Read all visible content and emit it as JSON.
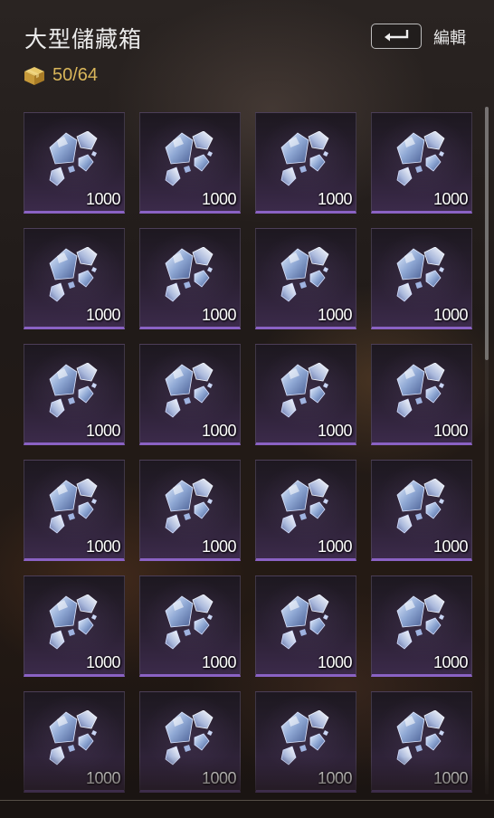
{
  "header": {
    "title": "大型儲藏箱",
    "capacity": "50/64",
    "edit_label": "編輯"
  },
  "icons": {
    "capacity": "box-icon",
    "back": "return-arrow-icon",
    "item": "crystal-shards-icon"
  },
  "colors": {
    "capacity_text": "#d9b65a",
    "slot_rarity_bar": "#8a62c4",
    "title_text": "#ececec"
  },
  "inventory": {
    "columns": 4,
    "items": [
      {
        "icon": "crystal-shards-icon",
        "quantity": "1000"
      },
      {
        "icon": "crystal-shards-icon",
        "quantity": "1000"
      },
      {
        "icon": "crystal-shards-icon",
        "quantity": "1000"
      },
      {
        "icon": "crystal-shards-icon",
        "quantity": "1000"
      },
      {
        "icon": "crystal-shards-icon",
        "quantity": "1000"
      },
      {
        "icon": "crystal-shards-icon",
        "quantity": "1000"
      },
      {
        "icon": "crystal-shards-icon",
        "quantity": "1000"
      },
      {
        "icon": "crystal-shards-icon",
        "quantity": "1000"
      },
      {
        "icon": "crystal-shards-icon",
        "quantity": "1000"
      },
      {
        "icon": "crystal-shards-icon",
        "quantity": "1000"
      },
      {
        "icon": "crystal-shards-icon",
        "quantity": "1000"
      },
      {
        "icon": "crystal-shards-icon",
        "quantity": "1000"
      },
      {
        "icon": "crystal-shards-icon",
        "quantity": "1000"
      },
      {
        "icon": "crystal-shards-icon",
        "quantity": "1000"
      },
      {
        "icon": "crystal-shards-icon",
        "quantity": "1000"
      },
      {
        "icon": "crystal-shards-icon",
        "quantity": "1000"
      },
      {
        "icon": "crystal-shards-icon",
        "quantity": "1000"
      },
      {
        "icon": "crystal-shards-icon",
        "quantity": "1000"
      },
      {
        "icon": "crystal-shards-icon",
        "quantity": "1000"
      },
      {
        "icon": "crystal-shards-icon",
        "quantity": "1000"
      },
      {
        "icon": "crystal-shards-icon",
        "quantity": "1000"
      },
      {
        "icon": "crystal-shards-icon",
        "quantity": "1000"
      },
      {
        "icon": "crystal-shards-icon",
        "quantity": "1000"
      },
      {
        "icon": "crystal-shards-icon",
        "quantity": "1000"
      }
    ]
  }
}
